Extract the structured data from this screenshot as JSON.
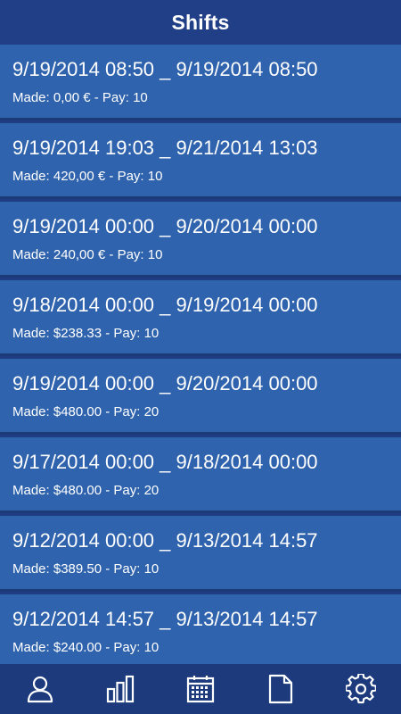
{
  "header": {
    "title": "Shifts"
  },
  "shifts": [
    {
      "dates": "9/19/2014 08:50 _ 9/19/2014 08:50",
      "summary": "Made: 0,00 € - Pay: 10"
    },
    {
      "dates": "9/19/2014 19:03 _ 9/21/2014 13:03",
      "summary": "Made: 420,00 € - Pay: 10"
    },
    {
      "dates": "9/19/2014 00:00 _ 9/20/2014 00:00",
      "summary": "Made: 240,00 € - Pay: 10"
    },
    {
      "dates": "9/18/2014 00:00 _ 9/19/2014 00:00",
      "summary": "Made: $238.33 - Pay: 10"
    },
    {
      "dates": "9/19/2014 00:00 _ 9/20/2014 00:00",
      "summary": "Made: $480.00 - Pay: 20"
    },
    {
      "dates": "9/17/2014 00:00 _ 9/18/2014 00:00",
      "summary": "Made: $480.00 - Pay: 20"
    },
    {
      "dates": "9/12/2014 00:00 _ 9/13/2014 14:57",
      "summary": "Made: $389.50 - Pay: 10"
    },
    {
      "dates": "9/12/2014 14:57 _ 9/13/2014 14:57",
      "summary": "Made: $240.00 - Pay: 10"
    }
  ],
  "bottom_nav": [
    {
      "icon": "person-icon"
    },
    {
      "icon": "bar-chart-icon"
    },
    {
      "icon": "calendar-icon"
    },
    {
      "icon": "document-icon"
    },
    {
      "icon": "gear-icon"
    }
  ],
  "colors": {
    "header_bg": "#213f87",
    "row_bg": "#2f63ad",
    "row_separator": "#1b3a78",
    "nav_bg": "#1c3a7c",
    "text": "#ffffff"
  }
}
